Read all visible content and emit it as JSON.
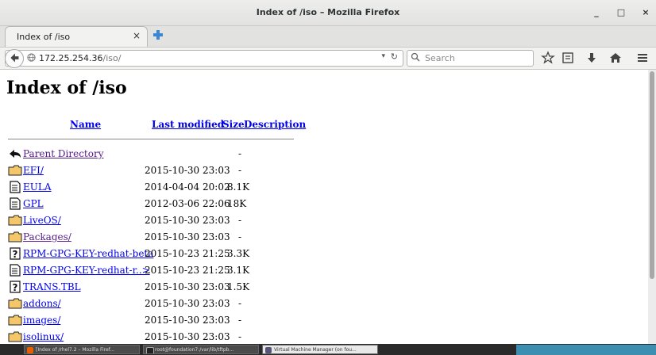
{
  "window": {
    "title": "Index of /iso – Mozilla Firefox",
    "minimize": "_",
    "maximize": "□",
    "close": "×"
  },
  "tabs": [
    {
      "label": "Index of /iso",
      "close": "×"
    }
  ],
  "nav": {
    "url_host": "172.25.254.36",
    "url_path": "/iso/",
    "search_placeholder": "Search"
  },
  "page": {
    "heading": "Index of /iso",
    "columns": {
      "name": "Name",
      "modified": "Last modified",
      "size": "Size",
      "description": "Description"
    },
    "entries": [
      {
        "icon": "back-icon",
        "name": "Parent Directory",
        "modified": "",
        "size": "-",
        "visited": true
      },
      {
        "icon": "folder-icon",
        "name": "EFI/",
        "modified": "2015-10-30 23:03",
        "size": "-",
        "visited": false
      },
      {
        "icon": "text-file-icon",
        "name": "EULA",
        "modified": "2014-04-04 20:02",
        "size": "8.1K",
        "visited": false
      },
      {
        "icon": "text-file-icon",
        "name": "GPL",
        "modified": "2012-03-06 22:06",
        "size": "18K",
        "visited": false
      },
      {
        "icon": "folder-icon",
        "name": "LiveOS/",
        "modified": "2015-10-30 23:03",
        "size": "-",
        "visited": false
      },
      {
        "icon": "folder-icon",
        "name": "Packages/",
        "modified": "2015-10-30 23:03",
        "size": "-",
        "visited": true
      },
      {
        "icon": "unknown-file-icon",
        "name": "RPM-GPG-KEY-redhat-beta",
        "modified": "2015-10-23 21:25",
        "size": "3.3K",
        "visited": false
      },
      {
        "icon": "text-file-icon",
        "name": "RPM-GPG-KEY-redhat-r..>",
        "modified": "2015-10-23 21:25",
        "size": "3.1K",
        "visited": false
      },
      {
        "icon": "unknown-file-icon",
        "name": "TRANS.TBL",
        "modified": "2015-10-30 23:03",
        "size": "1.5K",
        "visited": false
      },
      {
        "icon": "folder-icon",
        "name": "addons/",
        "modified": "2015-10-30 23:03",
        "size": "-",
        "visited": false
      },
      {
        "icon": "folder-icon",
        "name": "images/",
        "modified": "2015-10-30 23:03",
        "size": "-",
        "visited": false
      },
      {
        "icon": "folder-icon",
        "name": "isolinux/",
        "modified": "2015-10-30 23:03",
        "size": "-",
        "visited": false
      }
    ]
  },
  "taskbar": {
    "items": [
      {
        "label": "[Index of /rhel7.2 – Mozilla Firef...",
        "active": false
      },
      {
        "label": "root@foundation7:/var/lib/tftpb...",
        "active": false
      },
      {
        "label": "Virtual Machine Manager (on fou...",
        "active": true
      }
    ]
  },
  "colors": {
    "link": "#0000ee",
    "visited": "#551a8b",
    "folder": "#f0c674",
    "chrome_bg": "#e8e8e7"
  }
}
